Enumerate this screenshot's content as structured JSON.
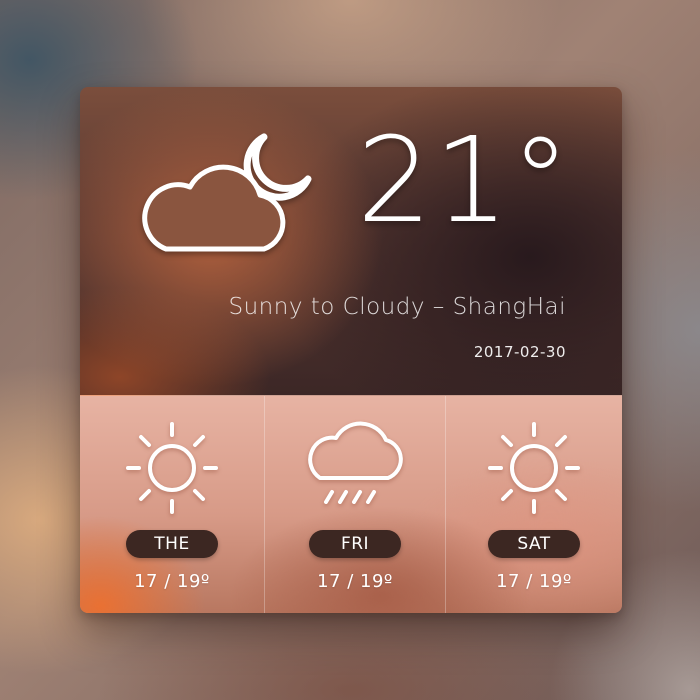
{
  "current": {
    "temperature": "21°",
    "condition_icon": "cloud-moon-icon",
    "description": "Sunny to Cloudy – ShangHai",
    "date": "2017-02-30"
  },
  "forecast": [
    {
      "day": "THE",
      "temp_range": "17 / 19º",
      "icon": "sun-icon"
    },
    {
      "day": "FRI",
      "temp_range": "17 / 19º",
      "icon": "rain-cloud-icon"
    },
    {
      "day": "SAT",
      "temp_range": "17 / 19º",
      "icon": "sun-icon"
    }
  ],
  "colors": {
    "label_pill": "#3c2722",
    "text": "#ffffff"
  }
}
